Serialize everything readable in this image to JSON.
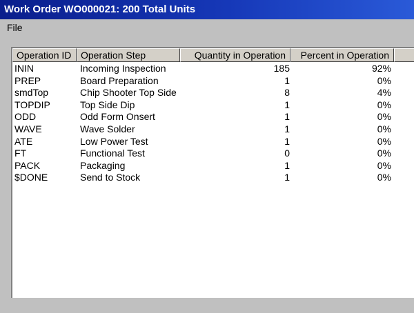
{
  "window": {
    "title": "Work Order WO000021:  200 Total Units"
  },
  "menu": {
    "file_label": "File"
  },
  "table": {
    "columns": [
      "Operation ID",
      "Operation Step",
      "Quantity in Operation",
      "Percent in Operation",
      ""
    ],
    "rows": [
      {
        "id": "ININ",
        "step": "Incoming Inspection",
        "qty": "185",
        "pct": "92%"
      },
      {
        "id": "PREP",
        "step": "Board Preparation",
        "qty": "1",
        "pct": "0%"
      },
      {
        "id": "smdTop",
        "step": "Chip Shooter Top Side",
        "qty": "8",
        "pct": "4%"
      },
      {
        "id": "TOPDIP",
        "step": "Top Side Dip",
        "qty": "1",
        "pct": "0%"
      },
      {
        "id": "ODD",
        "step": "Odd Form Onsert",
        "qty": "1",
        "pct": "0%"
      },
      {
        "id": "WAVE",
        "step": "Wave Solder",
        "qty": "1",
        "pct": "0%"
      },
      {
        "id": "ATE",
        "step": "Low Power Test",
        "qty": "1",
        "pct": "0%"
      },
      {
        "id": "FT",
        "step": "Functional Test",
        "qty": "0",
        "pct": "0%"
      },
      {
        "id": "PACK",
        "step": "Packaging",
        "qty": "1",
        "pct": "0%"
      },
      {
        "id": "$DONE",
        "step": "Send to Stock",
        "qty": "1",
        "pct": "0%"
      }
    ]
  },
  "colors": {
    "titlebar_start": "#0a1e8c",
    "titlebar_end": "#2a5ad8",
    "face": "#c0c0c0",
    "list_bg": "#ffffff"
  }
}
